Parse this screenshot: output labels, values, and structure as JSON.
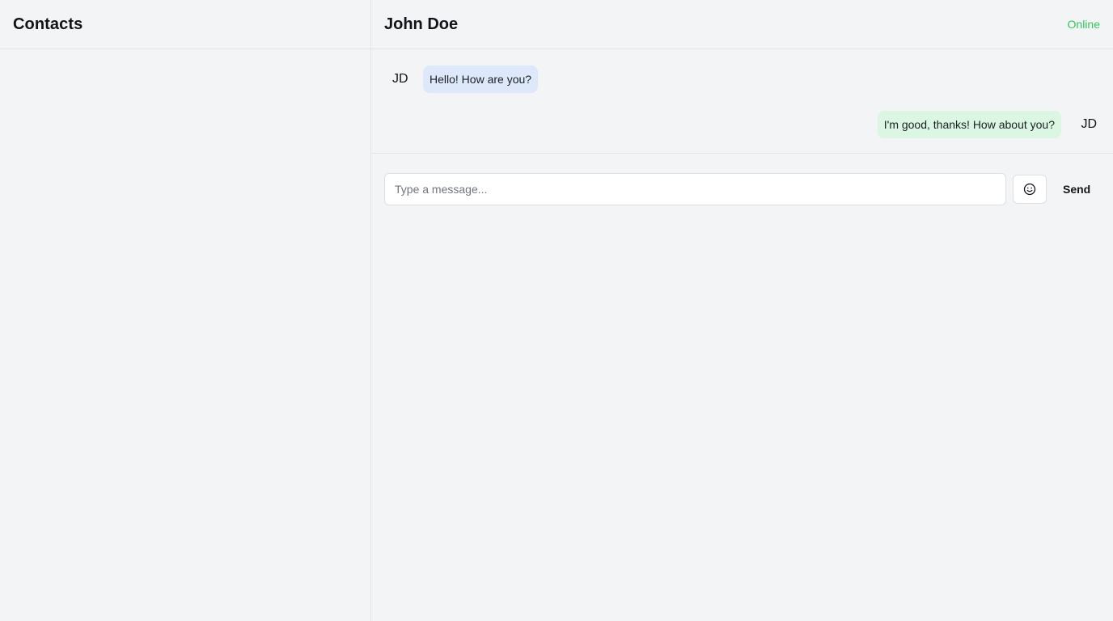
{
  "sidebar": {
    "title": "Contacts",
    "contacts": []
  },
  "chat": {
    "contact_name": "John Doe",
    "status": "Online",
    "status_color": "#34c759",
    "messages": [
      {
        "direction": "incoming",
        "avatar": "JD",
        "text": "Hello! How are you?",
        "bubble_color": "#dde9fb"
      },
      {
        "direction": "outgoing",
        "avatar": "JD",
        "text": "I'm good, thanks! How about you?",
        "bubble_color": "#dbf6e2"
      }
    ]
  },
  "composer": {
    "input_value": "",
    "placeholder": "Type a message...",
    "emoji_icon": "smiley-icon",
    "send_label": "Send"
  }
}
